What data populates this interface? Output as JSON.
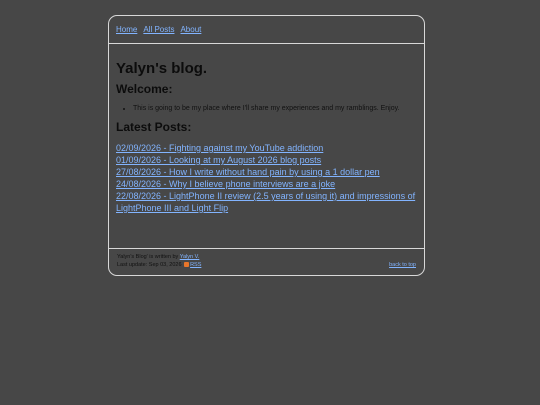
{
  "nav": {
    "home": "Home",
    "all_posts": "All Posts",
    "about": "About"
  },
  "main": {
    "title": "Yalyn's blog.",
    "welcome_heading": "Welcome:",
    "intro_items": [
      "This is going to be my place where I'll share my experiences and my ramblings. Enjoy."
    ],
    "latest_heading": "Latest Posts:",
    "posts": [
      "02/09/2026 - Fighting against my YouTube addiction",
      "01/09/2026 - Looking at my August 2026 blog posts",
      "27/08/2026 - How I write without hand pain by using a 1 dollar pen",
      "24/08/2026 - Why I believe phone interviews are a joke",
      "22/08/2026 - LightPhone II review (2.5 years of using it) and impressions of LightPhone III and Light Flip"
    ]
  },
  "footer": {
    "written_by_prefix": "Yalyn's Blog' is written by",
    "author": "Yalyn V.",
    "last_update": "Last update: Sep 03, 2026",
    "rss": "RSS",
    "back_to_top": "back to top"
  },
  "colors": {
    "background": "#474747",
    "border": "#d8d8d8",
    "link": "#82b4ff",
    "rss_icon": "#e8762b"
  }
}
